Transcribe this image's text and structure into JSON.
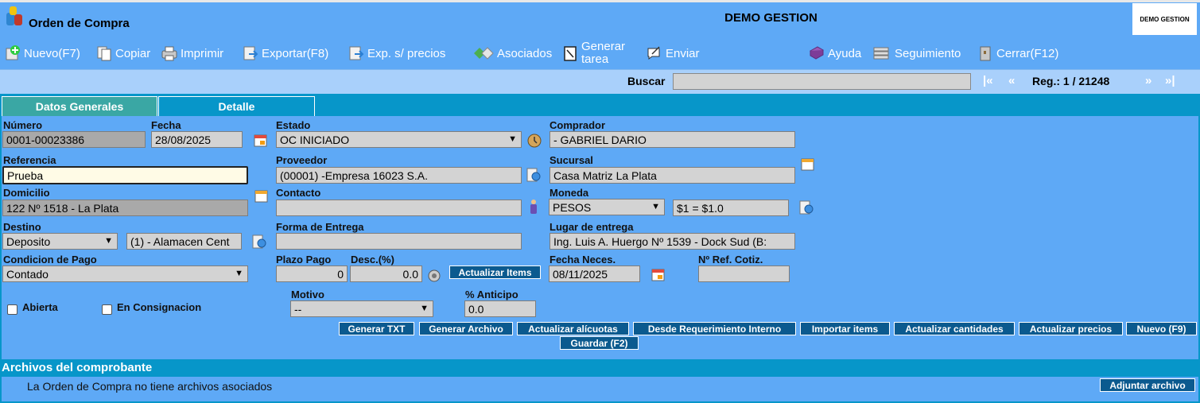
{
  "header": {
    "title": "Orden de Compra",
    "company": "DEMO GESTION",
    "logo_text": "DEMO GESTION"
  },
  "toolbar": {
    "nuevo": "Nuevo(F7)",
    "copiar": "Copiar",
    "imprimir": "Imprimir",
    "exportar": "Exportar(F8)",
    "exp_sin_precios": "Exp. s/ precios",
    "asociados": "Asociados",
    "generar_tarea_1": "Generar",
    "generar_tarea_2": "tarea",
    "enviar": "Enviar",
    "ayuda": "Ayuda",
    "seguimiento": "Seguimiento",
    "cerrar": "Cerrar(F12)"
  },
  "search": {
    "label": "Buscar",
    "value": "",
    "first": "|«",
    "prev": "«",
    "next": "»",
    "last": "»|",
    "reg": "Reg.: 1 / 21248"
  },
  "tabs": {
    "general": "Datos Generales",
    "detail": "Detalle"
  },
  "form": {
    "numero_label": "Número",
    "numero": "0001-00023386",
    "fecha_label": "Fecha",
    "fecha": "28/08/2025",
    "estado_label": "Estado",
    "estado": "OC INICIADO",
    "comprador_label": "Comprador",
    "comprador": "- GABRIEL DARIO",
    "referencia_label": "Referencia",
    "referencia": "Prueba",
    "proveedor_label": "Proveedor",
    "proveedor": "(00001) -Empresa 16023 S.A.",
    "sucursal_label": "Sucursal",
    "sucursal": "Casa Matriz La Plata",
    "domicilio_label": "Domicilio",
    "domicilio": "122 Nº 1518 - La Plata",
    "contacto_label": "Contacto",
    "contacto": "",
    "moneda_label": "Moneda",
    "moneda": "PESOS",
    "cotizacion": "$1 = $1.0",
    "destino_label": "Destino",
    "destino": "Deposito",
    "deposito": "(1) - Alamacen Cent",
    "forma_entrega_label": "Forma de Entrega",
    "forma_entrega": "",
    "lugar_entrega_label": "Lugar de entrega",
    "lugar_entrega": "Ing. Luis A. Huergo Nº 1539 - Dock Sud (B:",
    "condicion_pago_label": "Condicion de Pago",
    "condicion_pago": "Contado",
    "plazo_pago_label": "Plazo Pago",
    "plazo_pago": "0",
    "descuento_label": "Desc.(%)",
    "descuento": "0.0",
    "actualizar_items": "Actualizar Items",
    "fecha_neces_label": "Fecha Neces.",
    "fecha_neces": "08/11/2025",
    "ref_cotiz_label": "Nº Ref. Cotiz.",
    "ref_cotiz": "",
    "abierta_label": "Abierta",
    "consignacion_label": "En Consignacion",
    "motivo_label": "Motivo",
    "motivo": "--",
    "anticipo_label": "% Anticipo",
    "anticipo": "0.0"
  },
  "actions": {
    "generar_txt": "Generar TXT",
    "generar_archivo": "Generar Archivo",
    "actualizar_alicuotas": "Actualizar alícuotas",
    "desde_requerimiento": "Desde Requerimiento Interno",
    "importar_items": "Importar items",
    "actualizar_cantidades": "Actualizar cantidades",
    "actualizar_precios": "Actualizar precios",
    "nuevo_f9": "Nuevo (F9)",
    "guardar": "Guardar (F2)"
  },
  "files": {
    "title": "Archivos del comprobante",
    "empty": "La Orden de Compra no tiene archivos asociados",
    "adjuntar": "Adjuntar archivo"
  },
  "icons": {
    "nuevo": "plus-icon",
    "copiar": "copy-icon",
    "imprimir": "printer-icon",
    "exportar": "export-icon",
    "asociados": "link-icon",
    "generar_tarea": "task-icon",
    "enviar": "send-icon",
    "ayuda": "help-book-icon",
    "seguimiento": "tracking-icon",
    "cerrar": "close-icon"
  }
}
